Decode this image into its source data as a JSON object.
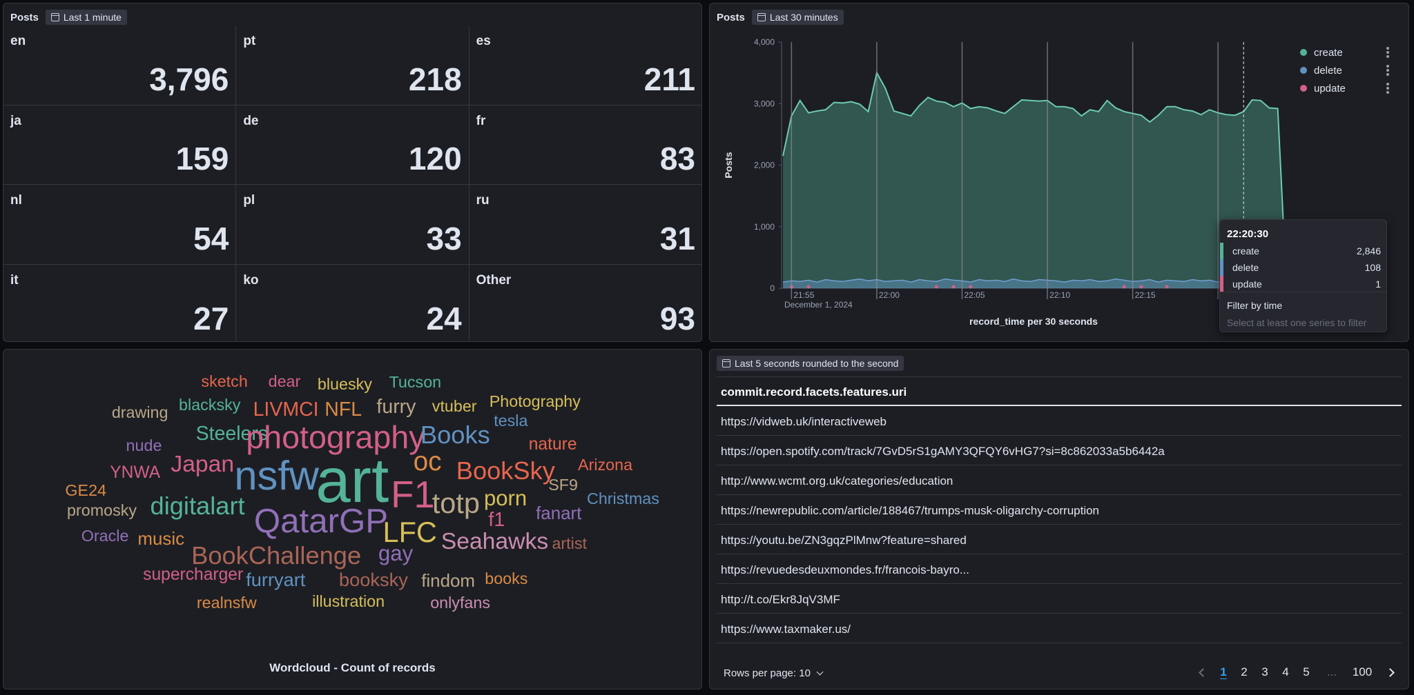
{
  "metric_panel": {
    "title": "Posts",
    "time_badge": "Last 1 minute",
    "cells": [
      {
        "label": "en",
        "value": "3,796"
      },
      {
        "label": "pt",
        "value": "218"
      },
      {
        "label": "es",
        "value": "211"
      },
      {
        "label": "ja",
        "value": "159"
      },
      {
        "label": "de",
        "value": "120"
      },
      {
        "label": "fr",
        "value": "83"
      },
      {
        "label": "nl",
        "value": "54"
      },
      {
        "label": "pl",
        "value": "33"
      },
      {
        "label": "ru",
        "value": "31"
      },
      {
        "label": "it",
        "value": "27"
      },
      {
        "label": "ko",
        "value": "24"
      },
      {
        "label": "Other",
        "value": "93"
      }
    ]
  },
  "chart_panel": {
    "title": "Posts",
    "time_badge": "Last 30 minutes",
    "legend": [
      {
        "name": "create",
        "color": "#54b399"
      },
      {
        "name": "delete",
        "color": "#6092c0"
      },
      {
        "name": "update",
        "color": "#d36086"
      }
    ],
    "tooltip": {
      "title": "22:20:30",
      "rows": [
        {
          "name": "create",
          "value": "2,846",
          "color": "#54b399"
        },
        {
          "name": "delete",
          "value": "108",
          "color": "#6092c0"
        },
        {
          "name": "update",
          "value": "1",
          "color": "#d36086"
        }
      ],
      "action": "Filter by time",
      "hint": "Select at least one series to filter"
    }
  },
  "chart_data": {
    "type": "area",
    "title": "",
    "xlabel": "record_time per 30 seconds",
    "ylabel": "Posts",
    "ylim": [
      0,
      4000
    ],
    "y_ticks": [
      "0",
      "1,000",
      "2,000",
      "3,000",
      "4,000"
    ],
    "x_ticks": [
      "21:55",
      "22:00",
      "22:05",
      "22:10",
      "22:15",
      "22:2"
    ],
    "x_sublabel": "December 1, 2024",
    "grid": false,
    "legend_position": "top-right",
    "series": [
      {
        "name": "create",
        "values": [
          2150,
          2800,
          3050,
          2850,
          2880,
          2900,
          3020,
          3010,
          3030,
          2990,
          2870,
          3500,
          3250,
          2880,
          2840,
          2800,
          2970,
          3100,
          3040,
          3020,
          2950,
          3010,
          2920,
          2950,
          2930,
          2880,
          2840,
          2950,
          3060,
          3050,
          3040,
          3050,
          2950,
          2950,
          2920,
          2800,
          2900,
          2870,
          3050,
          2930,
          2870,
          2840,
          2810,
          2700,
          2810,
          2950,
          2950,
          2900,
          2880,
          2820,
          2900,
          2850,
          2820,
          2810,
          2870,
          3060,
          3050,
          2930,
          2920,
          100
        ]
      },
      {
        "name": "delete",
        "values": [
          100,
          120,
          110,
          130,
          100,
          140,
          120,
          110,
          130,
          150,
          120,
          140,
          110,
          120,
          130,
          100,
          140,
          120,
          110,
          150,
          130,
          120,
          100,
          140,
          120,
          130,
          110,
          150,
          120,
          110,
          140,
          130,
          120,
          100,
          130,
          120,
          140,
          110,
          120,
          150,
          130,
          110,
          120,
          140,
          100,
          130,
          120,
          110,
          140,
          120,
          130,
          100,
          120,
          140,
          108,
          130,
          120,
          110,
          130,
          20
        ]
      },
      {
        "name": "update",
        "values": [
          0,
          2,
          0,
          1,
          0,
          0,
          0,
          0,
          0,
          0,
          0,
          0,
          0,
          0,
          0,
          0,
          0,
          0,
          2,
          0,
          1,
          0,
          3,
          0,
          0,
          0,
          0,
          0,
          0,
          0,
          0,
          0,
          0,
          0,
          0,
          0,
          0,
          0,
          0,
          0,
          2,
          0,
          1,
          0,
          0,
          1,
          0,
          0,
          0,
          0,
          0,
          0,
          0,
          0,
          0,
          1,
          0,
          2,
          0,
          0
        ]
      }
    ]
  },
  "wordcloud": {
    "title": "Wordcloud - Count of records",
    "words": [
      {
        "text": "sketch",
        "color": "#e7664c"
      },
      {
        "text": "dear",
        "color": "#d36086"
      },
      {
        "text": "bluesky",
        "color": "#d6bf57"
      },
      {
        "text": "Tucson",
        "color": "#54b399"
      },
      {
        "text": "drawing",
        "color": "#b9a888"
      },
      {
        "text": "blacksky",
        "color": "#54b399"
      },
      {
        "text": "LIVMCI",
        "color": "#e7664c"
      },
      {
        "text": "NFL",
        "color": "#da8b45"
      },
      {
        "text": "furry",
        "color": "#b9a888"
      },
      {
        "text": "vtuber",
        "color": "#d6bf57"
      },
      {
        "text": "Photography",
        "color": "#d6bf57"
      },
      {
        "text": "tesla",
        "color": "#6092c0"
      },
      {
        "text": "Steelers",
        "color": "#54b399"
      },
      {
        "text": "photography",
        "color": "#d36086"
      },
      {
        "text": "Books",
        "color": "#6092c0"
      },
      {
        "text": "nature",
        "color": "#e7664c"
      },
      {
        "text": "nude",
        "color": "#9170b8"
      },
      {
        "text": "Japan",
        "color": "#d36086"
      },
      {
        "text": "oc",
        "color": "#da8b45"
      },
      {
        "text": "BookSky",
        "color": "#e7664c"
      },
      {
        "text": "Arizona",
        "color": "#e7664c"
      },
      {
        "text": "YNWA",
        "color": "#d36086"
      },
      {
        "text": "nsfw",
        "color": "#6092c0"
      },
      {
        "text": "art",
        "color": "#54b399"
      },
      {
        "text": "F1",
        "color": "#d36086"
      },
      {
        "text": "SF9",
        "color": "#b9a888"
      },
      {
        "text": "GE24",
        "color": "#da8b45"
      },
      {
        "text": "totp",
        "color": "#b9a888"
      },
      {
        "text": "porn",
        "color": "#d6bf57"
      },
      {
        "text": "Christmas",
        "color": "#6092c0"
      },
      {
        "text": "promosky",
        "color": "#b9a888"
      },
      {
        "text": "digitalart",
        "color": "#54b399"
      },
      {
        "text": "f1",
        "color": "#d36086"
      },
      {
        "text": "fanart",
        "color": "#9170b8"
      },
      {
        "text": "QatarGP",
        "color": "#9170b8"
      },
      {
        "text": "LFC",
        "color": "#d6bf57"
      },
      {
        "text": "Oracle",
        "color": "#9170b8"
      },
      {
        "text": "music",
        "color": "#da8b45"
      },
      {
        "text": "Seahawks",
        "color": "#ca8eae"
      },
      {
        "text": "artist",
        "color": "#aa6556"
      },
      {
        "text": "BookChallenge",
        "color": "#aa6556"
      },
      {
        "text": "gay",
        "color": "#9170b8"
      },
      {
        "text": "supercharger",
        "color": "#d36086"
      },
      {
        "text": "furryart",
        "color": "#6092c0"
      },
      {
        "text": "booksky",
        "color": "#aa6556"
      },
      {
        "text": "findom",
        "color": "#b9a888"
      },
      {
        "text": "books",
        "color": "#da8b45"
      },
      {
        "text": "realnsfw",
        "color": "#da8b45"
      },
      {
        "text": "illustration",
        "color": "#d6bf57"
      },
      {
        "text": "onlyfans",
        "color": "#ca8eae"
      }
    ]
  },
  "table_panel": {
    "time_badge": "Last 5 seconds rounded to the second",
    "column_header": "commit.record.facets.features.uri",
    "rows": [
      "https://vidweb.uk/interactiveweb",
      "https://open.spotify.com/track/7GvD5rS1gAMY3QFQY6vHG7?si=8c862033a5b6442a",
      "http://www.wcmt.org.uk/categories/education",
      "https://newrepublic.com/article/188467/trumps-musk-oligarchy-corruption",
      "https://youtu.be/ZN3gqzPlMnw?feature=shared",
      "https://revuedesdeuxmondes.fr/francois-bayro...",
      "http://t.co/Ekr8JqV3MF",
      "https://www.taxmaker.us/"
    ],
    "rows_per_page_label": "Rows per page: 10",
    "pages": [
      "1",
      "2",
      "3",
      "4",
      "5",
      "...",
      "100"
    ],
    "active_page": "1"
  }
}
